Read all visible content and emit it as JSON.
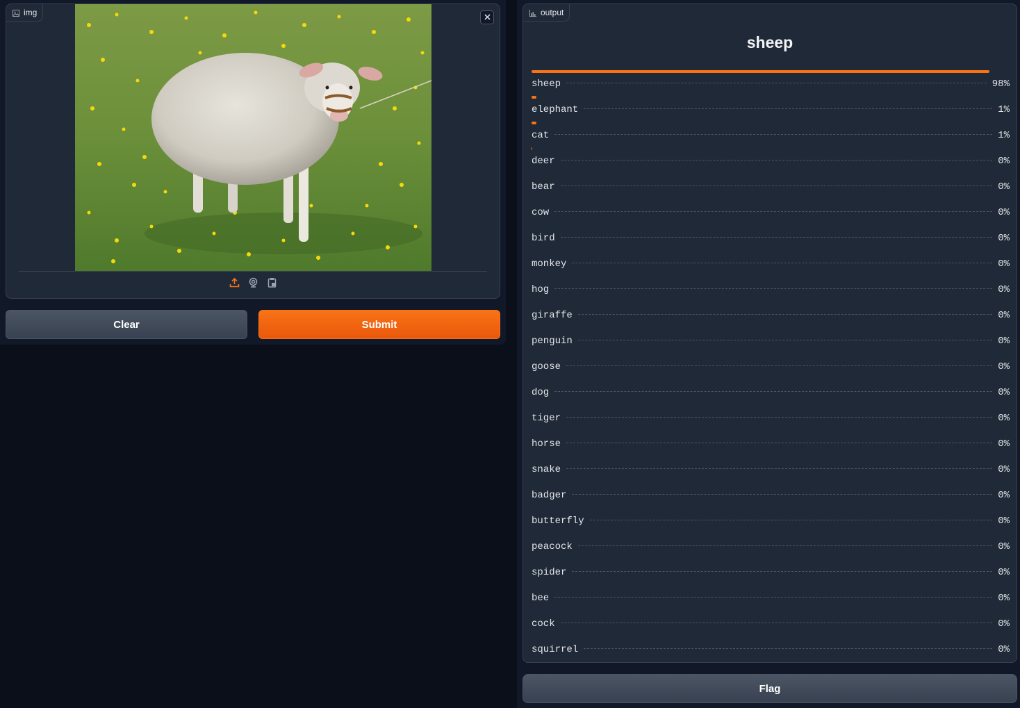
{
  "input": {
    "label": "img",
    "image_alt": "sheep standing on grass with yellow dandelions"
  },
  "buttons": {
    "clear": "Clear",
    "submit": "Submit",
    "flag": "Flag"
  },
  "output": {
    "label": "output",
    "top_label": "sheep",
    "confidences": [
      {
        "label": "sheep",
        "pct": "98%",
        "value": 0.98
      },
      {
        "label": "elephant",
        "pct": "1%",
        "value": 0.01
      },
      {
        "label": "cat",
        "pct": "1%",
        "value": 0.01
      },
      {
        "label": "deer",
        "pct": "0%",
        "value": 0.002
      },
      {
        "label": "bear",
        "pct": "0%",
        "value": 0
      },
      {
        "label": "cow",
        "pct": "0%",
        "value": 0
      },
      {
        "label": "bird",
        "pct": "0%",
        "value": 0
      },
      {
        "label": "monkey",
        "pct": "0%",
        "value": 0
      },
      {
        "label": "hog",
        "pct": "0%",
        "value": 0
      },
      {
        "label": "giraffe",
        "pct": "0%",
        "value": 0
      },
      {
        "label": "penguin",
        "pct": "0%",
        "value": 0
      },
      {
        "label": "goose",
        "pct": "0%",
        "value": 0
      },
      {
        "label": "dog",
        "pct": "0%",
        "value": 0
      },
      {
        "label": "tiger",
        "pct": "0%",
        "value": 0
      },
      {
        "label": "horse",
        "pct": "0%",
        "value": 0
      },
      {
        "label": "snake",
        "pct": "0%",
        "value": 0
      },
      {
        "label": "badger",
        "pct": "0%",
        "value": 0
      },
      {
        "label": "butterfly",
        "pct": "0%",
        "value": 0
      },
      {
        "label": "peacock",
        "pct": "0%",
        "value": 0
      },
      {
        "label": "spider",
        "pct": "0%",
        "value": 0
      },
      {
        "label": "bee",
        "pct": "0%",
        "value": 0
      },
      {
        "label": "cock",
        "pct": "0%",
        "value": 0
      },
      {
        "label": "squirrel",
        "pct": "0%",
        "value": 0
      }
    ]
  },
  "colors": {
    "accent": "#f97316",
    "background": "#0b0f19",
    "panel": "#1f2937"
  },
  "icons": {
    "input_label": "image-icon",
    "output_label": "bar-chart-icon",
    "close": "close-icon",
    "sources": [
      "upload-icon",
      "webcam-icon",
      "clipboard-icon"
    ]
  }
}
